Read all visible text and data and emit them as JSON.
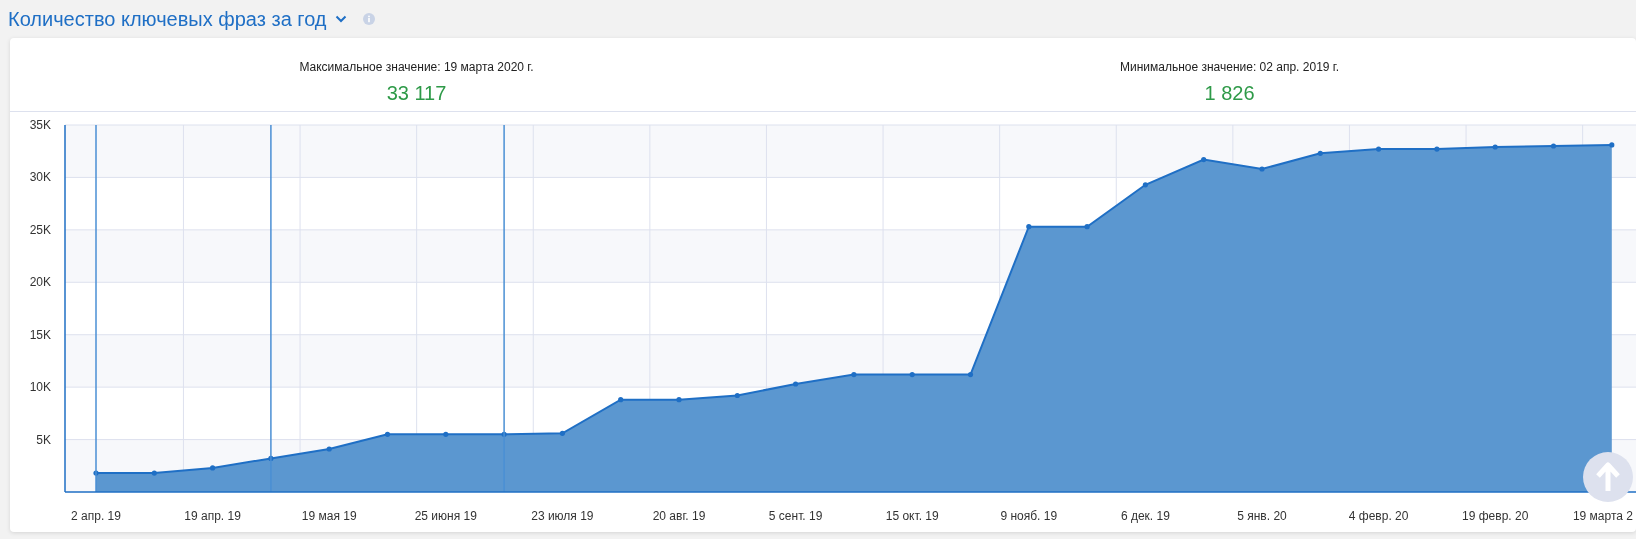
{
  "header": {
    "title": "Количество ключевых фраз за год"
  },
  "stats": [
    {
      "label": "Максимальное значение: 19 марта 2020 г.",
      "value": "33 117"
    },
    {
      "label": "Минимальное значение: 02 апр. 2019 г.",
      "value": "1 826"
    }
  ],
  "chart": {
    "chart_data": {
      "type": "area",
      "categories": [
        "2 апр. 19",
        null,
        "19 апр. 19",
        null,
        "19 мая 19",
        null,
        "25 июня 19",
        null,
        "23 июля 19",
        null,
        "20 авг. 19",
        null,
        "5 сент. 19",
        null,
        "15 окт. 19",
        null,
        "9 нояб. 19",
        null,
        "6 дек. 19",
        null,
        "5 янв. 20",
        null,
        "4 февр. 20",
        null,
        "19 февр. 20",
        null,
        "19 марта 2"
      ],
      "series": [
        {
          "color": "#5b97d0",
          "values": [
            1800,
            1800,
            2300,
            3200,
            4100,
            5500,
            5500,
            5500,
            5600,
            8800,
            8800,
            9200,
            10300,
            11200,
            11200,
            11200,
            25300,
            25300,
            29300,
            31700,
            30800,
            32300,
            32700,
            32700,
            32900,
            33000,
            33100
          ]
        }
      ],
      "ylim": [
        0,
        35000
      ],
      "yticks": [
        {
          "value": 5000,
          "label": "5K"
        },
        {
          "value": 10000,
          "label": "10K"
        },
        {
          "value": 15000,
          "label": "15K"
        },
        {
          "value": 20000,
          "label": "20K"
        },
        {
          "value": 25000,
          "label": "25K"
        },
        {
          "value": 30000,
          "label": "30K"
        },
        {
          "value": 35000,
          "label": "35K"
        }
      ],
      "grid": true
    }
  }
}
